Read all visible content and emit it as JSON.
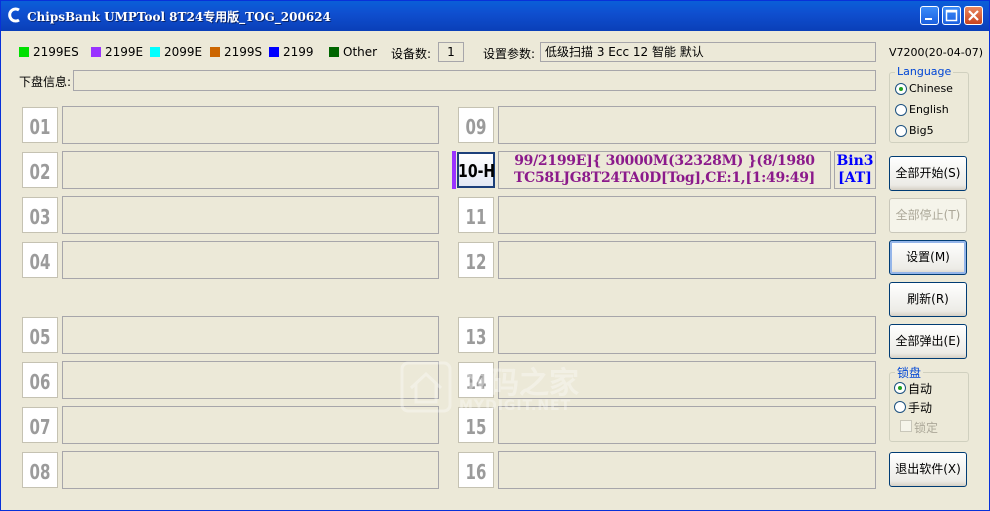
{
  "window": {
    "title": "ChipsBank UMPTool 8T24专用版_TOG_200624",
    "app_icon": "chipsbank-logo-icon",
    "controls": [
      "minimize-icon",
      "maximize-icon",
      "close-icon"
    ]
  },
  "legend": [
    {
      "label": "2199ES",
      "color": "#00e000"
    },
    {
      "label": "2199E",
      "color": "#9933ff"
    },
    {
      "label": "2099E",
      "color": "#00ffff"
    },
    {
      "label": "2199S",
      "color": "#cc6600"
    },
    {
      "label": "2199",
      "color": "#0000ff"
    },
    {
      "label": "Other",
      "color": "#006600"
    }
  ],
  "device_count": {
    "label": "设备数:",
    "value": "1"
  },
  "settings": {
    "label": "设置参数:",
    "value": "低级扫描 3 Ecc 12 智能 默认"
  },
  "version": "V7200(20-04-07)",
  "download_info": {
    "label": "下盘信息:",
    "value": ""
  },
  "ports": {
    "p01": "01",
    "p02": "02",
    "p03": "03",
    "p04": "04",
    "p05": "05",
    "p06": "06",
    "p07": "07",
    "p08": "08",
    "p09": "09",
    "p10": "10-H",
    "p11": "11",
    "p12": "12",
    "p13": "13",
    "p14": "14",
    "p15": "15",
    "p16": "16"
  },
  "active_port": {
    "line1": "99/2199E]{ 30000M(32328M) }(8/1980",
    "line2": "TC58LJG8T24TA0D[Tog],CE:1,[1:49:49]",
    "bin": "Bin3",
    "tag": "[AT]",
    "color": "#8b1a8b",
    "bin_color": "#0000ff"
  },
  "language": {
    "title": "Language",
    "options": [
      "Chinese",
      "English",
      "Big5"
    ],
    "selected": "Chinese"
  },
  "buttons": {
    "start_all": "全部开始(S)",
    "stop_all": "全部停止(T)",
    "setup": "设置(M)",
    "refresh": "刷新(R)",
    "eject_all": "全部弹出(E)",
    "exit": "退出软件(X)"
  },
  "lock": {
    "title": "锁盘",
    "auto": "自动",
    "manual": "手动",
    "lock_label": "锁定",
    "selected": "自动"
  },
  "watermark": {
    "cn": "数码之家",
    "en": "MYDIGIT.NET"
  }
}
